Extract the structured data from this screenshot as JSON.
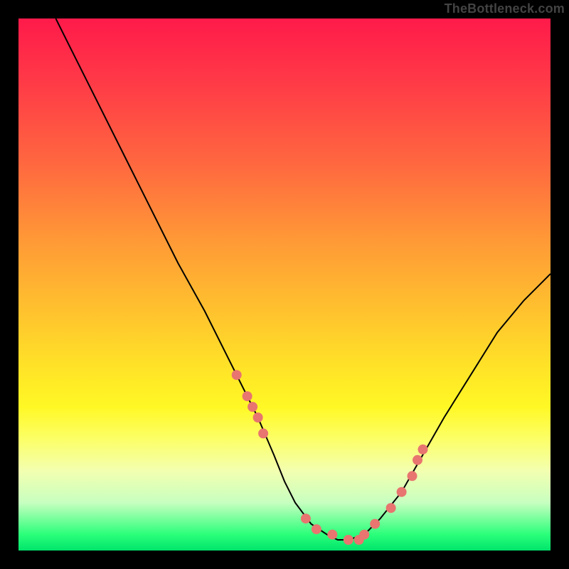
{
  "watermark": "TheBottleneck.com",
  "chart_data": {
    "type": "line",
    "title": "",
    "xlabel": "",
    "ylabel": "",
    "xlim": [
      0,
      100
    ],
    "ylim": [
      0,
      100
    ],
    "curve": {
      "name": "bottleneck-curve",
      "x": [
        7,
        10,
        15,
        20,
        25,
        30,
        35,
        40,
        45,
        48,
        50,
        52,
        55,
        58,
        60,
        62,
        65,
        68,
        72,
        76,
        80,
        85,
        90,
        95,
        100
      ],
      "y": [
        100,
        94,
        84,
        74,
        64,
        54,
        45,
        35,
        25,
        18,
        13,
        9,
        5,
        3,
        2,
        2,
        3,
        6,
        11,
        18,
        25,
        33,
        41,
        47,
        52
      ]
    },
    "markers": {
      "name": "highlight-dots",
      "x": [
        41,
        43,
        44,
        45,
        46,
        54,
        56,
        59,
        62,
        64,
        65,
        67,
        70,
        72,
        74,
        75,
        76
      ],
      "y": [
        33,
        29,
        27,
        25,
        22,
        6,
        4,
        3,
        2,
        2,
        3,
        5,
        8,
        11,
        14,
        17,
        19
      ]
    }
  }
}
